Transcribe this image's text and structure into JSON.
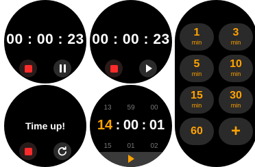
{
  "screens": {
    "running": {
      "time": "00 : 00 : 23"
    },
    "paused": {
      "time": "00 : 00 : 23"
    },
    "finished": {
      "message": "Time up!"
    },
    "picker": {
      "prev": [
        "13",
        "59",
        "00"
      ],
      "current": {
        "hours": "14",
        "minutes": "00",
        "seconds": "01"
      },
      "next": [
        "15",
        "01",
        "02"
      ]
    },
    "presets": {
      "items": [
        {
          "value": "1",
          "unit": "min"
        },
        {
          "value": "3",
          "unit": "min"
        },
        {
          "value": "5",
          "unit": "min"
        },
        {
          "value": "10",
          "unit": "min"
        },
        {
          "value": "15",
          "unit": "min"
        },
        {
          "value": "30",
          "unit": "min"
        },
        {
          "value": "60",
          "unit": ""
        }
      ],
      "add_symbol": "+"
    }
  },
  "icons": {
    "stop": "stop-icon",
    "pause": "pause-icon",
    "play": "play-icon",
    "restart": "restart-icon",
    "add": "plus-icon"
  },
  "colors": {
    "accent": "#ffa200",
    "stop": "#ff2b2b",
    "button_bg": "#2b2b2b",
    "screen_bg": "#000000"
  }
}
